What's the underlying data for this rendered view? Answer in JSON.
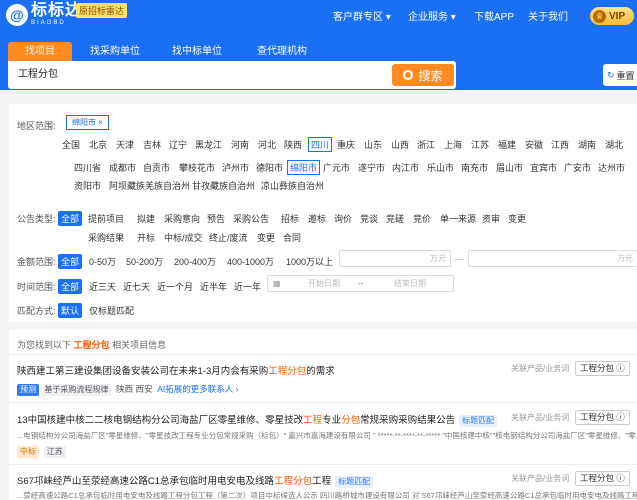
{
  "header": {
    "logo_mark": "@",
    "logo_name": "标标达",
    "logo_sub": "BIAOBD",
    "radar_badge": "原招标雷达",
    "nav": [
      "客户群专区 ▾",
      "企业服务 ▾",
      "下载APP",
      "关于我们"
    ],
    "vip_label": "VIP",
    "vip_crown": "♛"
  },
  "search": {
    "tabs": [
      "找项目",
      "找采购单位",
      "找中标单位",
      "查代理机构"
    ],
    "active_tab": 0,
    "query": "工程分包",
    "button_label": "搜索",
    "reset_label": "重置",
    "reset_icon": "↻"
  },
  "filters": {
    "region": {
      "label": "地区范围:",
      "selected_chip": "绵阳市 ×",
      "provinces": [
        "全国",
        "北京",
        "天津",
        "吉林",
        "辽宁",
        "黑龙江",
        "河南",
        "河北",
        "陕西",
        "四川",
        "重庆",
        "山东",
        "山西",
        "浙江",
        "上海",
        "江苏",
        "福建",
        "安徽",
        "江西",
        "湖南",
        "湖北"
      ],
      "selected_province": "四川",
      "cities_row1": [
        "四川省",
        "成都市",
        "自贡市",
        "攀枝花市",
        "泸州市",
        "德阳市",
        "绵阳市",
        "广元市",
        "遂宁市",
        "内江市",
        "乐山市",
        "南充市",
        "眉山市",
        "宜宾市",
        "广安市",
        "达州市"
      ],
      "selected_city": "绵阳市",
      "cities_row2": [
        "资阳市",
        "阿坝藏族羌族自治州",
        "甘孜藏族自治州",
        "凉山彝族自治州"
      ]
    },
    "notice_type": {
      "label": "公告类型:",
      "row1": [
        "全部",
        "提前项目",
        "拟建",
        "采购意向",
        "预告",
        "采购公告",
        "招标",
        "邀标",
        "询价",
        "竞谈",
        "竞磋",
        "竞价",
        "单一来源",
        "资审",
        "变更"
      ],
      "row2": [
        "采购结果",
        "开标",
        "中标/成交",
        "终止/废流",
        "变更",
        "合同"
      ]
    },
    "amount": {
      "label": "金额范围:",
      "options": [
        "全部",
        "0-50万",
        "50-200万",
        "200-400万",
        "400-1000万",
        "1000万以上"
      ],
      "unit_min": "万元",
      "unit_max": "万元",
      "dash": "—"
    },
    "time": {
      "label": "时间范围:",
      "options": [
        "全部",
        "近三天",
        "近七天",
        "近一个月",
        "近半年",
        "近一年"
      ],
      "start_placeholder": "开始日期",
      "sep": "--",
      "end_placeholder": "结束日期",
      "calendar_icon": "▦"
    },
    "match": {
      "label": "匹配方式:",
      "options": [
        "默认",
        "仅标题匹配"
      ]
    }
  },
  "results": {
    "summary_prefix": "为您找到以下",
    "summary_keyword": "工程分包",
    "summary_suffix": "相关项目信息",
    "items": [
      {
        "title_a": "陕西建工第三建设集团设备安装公司在未来1-3月内会有采购",
        "title_kw": "工程分包",
        "title_b": "的需求",
        "related": "关联产品/业务词",
        "pill": "工程分包 ⓘ",
        "tag1": "预测",
        "tag2": "基于采购流程规律",
        "location": "陕西 西安",
        "ai_text": "AI拓展的更多联系人 ›"
      },
      {
        "title_a": "13中国核建中核二二核电钢结构分公司海盐厂区零星维修、零星技改",
        "title_kw": "工程",
        "title_mid": "专业",
        "title_kw2": "分包",
        "title_b": "常规采购采购结果公告",
        "match_tag": "标题匹配",
        "related": "关联产品/业务词",
        "pill": "工程分包 ⓘ",
        "excerpt": "...电钢结构分公司海盐厂区\"零星维修、\"零星技改工程专业分包常规采购（标包）\" 嘉兴市嘉海建设有限公司 \" *****-**-****-**-***** \"中国核建中核\"\"核电钢结构分公司海盐厂区\"零星维修、\"零...",
        "tag_region": "中标",
        "location": "江苏"
      },
      {
        "title_a": "S67邛崃经芦山至荥经高速公路C1总承包临时用电安电及线路",
        "title_kw": "工程分包",
        "title_b": "工程",
        "match_tag": "标题匹配",
        "related": "关联产品/业务词",
        "pill": "工程分包 ⓘ",
        "excerpt": "...荥经高速公路C1总承包临时用电安电及线路工程分包工程（第二次）项目中标候选人公示 四川路桥城市建设有限公司 对 S67邛崃经芦山至荥经高速公路C1总承包临时用电安电及线路工程分包..."
      }
    ]
  }
}
